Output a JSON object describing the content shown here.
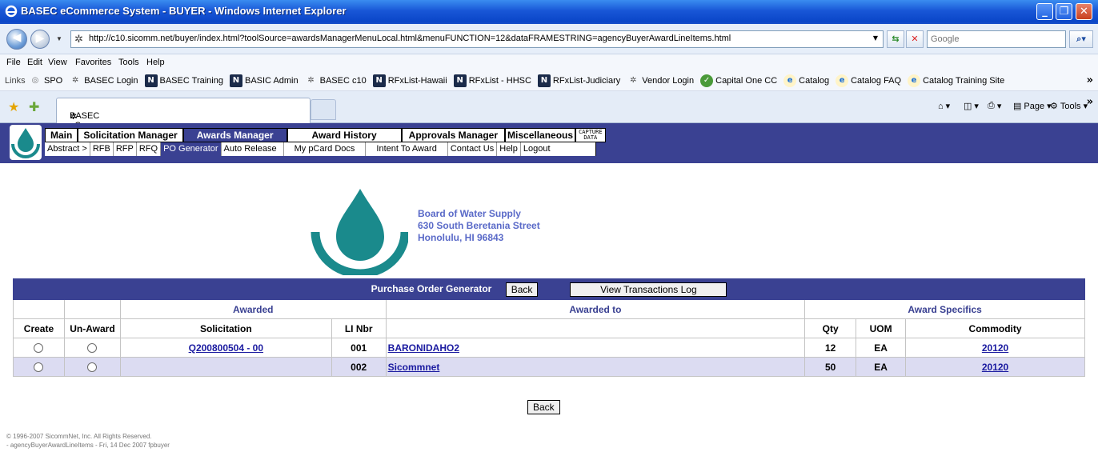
{
  "window": {
    "title": "BASEC eCommerce System - BUYER - Windows Internet Explorer"
  },
  "address_bar": {
    "url": "http://c10.sicomm.net/buyer/index.html?toolSource=awardsManagerMenuLocal.html&menuFUNCTION=12&dataFRAMESTRING=agencyBuyerAwardLineItems.html",
    "search_placeholder": "Google"
  },
  "menu": [
    "File",
    "Edit",
    "View",
    "Favorites",
    "Tools",
    "Help"
  ],
  "links_bar": {
    "label": "Links",
    "items": [
      {
        "label": "SPO",
        "icon": "spo-icon"
      },
      {
        "label": "BASEC Login",
        "icon": "basec-icon"
      },
      {
        "label": "BASEC Training",
        "icon": "n-icon"
      },
      {
        "label": "BASIC Admin",
        "icon": "n-icon"
      },
      {
        "label": "BASEC c10",
        "icon": "basec-icon"
      },
      {
        "label": "RFxList-Hawaii",
        "icon": "n-icon"
      },
      {
        "label": "RFxList - HHSC",
        "icon": "n-icon"
      },
      {
        "label": "RFxList-Judiciary",
        "icon": "n-icon"
      },
      {
        "label": "Vendor Login",
        "icon": "basec-icon"
      },
      {
        "label": "Capital One CC",
        "icon": "capital-one-icon"
      },
      {
        "label": "Catalog",
        "icon": "ie-page-icon"
      },
      {
        "label": "Catalog FAQ",
        "icon": "ie-page-icon"
      },
      {
        "label": "Catalog Training Site",
        "icon": "ie-page-icon"
      }
    ]
  },
  "tabs": {
    "active_tab": "BASEC eCommerce System - BUYER",
    "page_label": "Page",
    "tools_label": "Tools"
  },
  "app_nav": {
    "row1": [
      "Main",
      "Solicitation Manager",
      "Awards Manager",
      "Award History",
      "Approvals Manager",
      "Miscellaneous"
    ],
    "capture_line1": "CAPTURE",
    "capture_line2": "DATA",
    "row2": [
      "Abstract >",
      "RFB",
      "RFP",
      "RFQ",
      "PO Generator",
      "Auto Release",
      "My pCard Docs",
      "Intent To Award",
      "Contact Us",
      "Help",
      "Logout"
    ]
  },
  "org": {
    "name": "Board of Water Supply",
    "street": "630 South Beretania Street",
    "city": "Honolulu, HI 96843"
  },
  "po_generator": {
    "title": "Purchase Order Generator",
    "back_label": "Back",
    "view_log_label": "View Transactions Log",
    "group_headers": {
      "awarded": "Awarded",
      "awarded_to": "Awarded to",
      "award_specifics": "Award Specifics"
    },
    "columns": {
      "create": "Create",
      "unaward": "Un-Award",
      "solicitation": "Solicitation",
      "li_nbr": "LI Nbr",
      "qty": "Qty",
      "uom": "UOM",
      "commodity": "Commodity"
    },
    "rows": [
      {
        "solicitation": "Q200800504 - 00",
        "li_nbr": "001",
        "vendor": "BARONIDAHO2",
        "qty": "12",
        "uom": "EA",
        "commodity": "20120"
      },
      {
        "solicitation": "",
        "li_nbr": "002",
        "vendor": "Sicommnet",
        "qty": "50",
        "uom": "EA",
        "commodity": "20120"
      }
    ],
    "bottom_back_label": "Back"
  },
  "footer": {
    "copyright": "© 1996-2007 SicommNet, Inc. All Rights Reserved.",
    "page_info": "- agencyBuyerAwardLineItems -     Fri, 14 Dec 2007 fpbuyer"
  },
  "colors": {
    "nav_bar": "#3a4192",
    "logo_teal": "#1a8a8c",
    "address_text": "#5a6ac8",
    "alt_row": "#dcdcf2"
  }
}
